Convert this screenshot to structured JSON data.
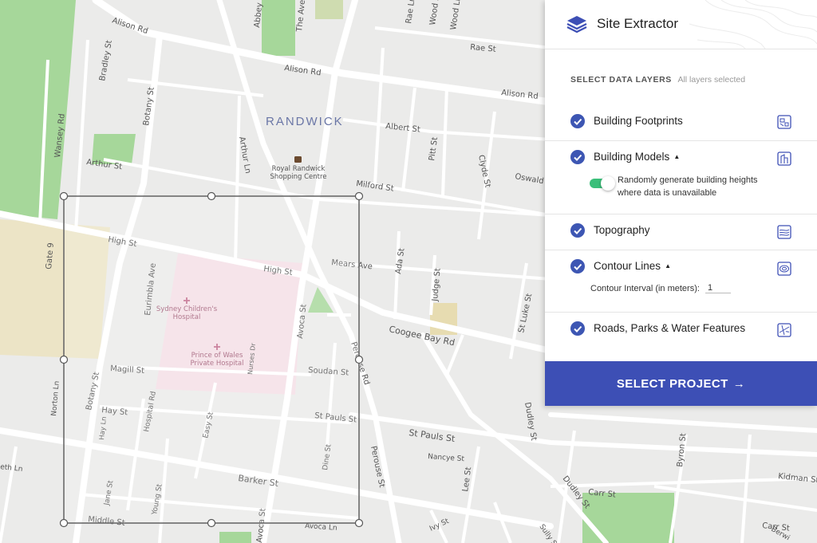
{
  "app": {
    "title": "Site Extractor"
  },
  "layers_panel": {
    "heading": "SELECT DATA LAYERS",
    "subheading": "All layers selected",
    "accent_color": "#3d56b3",
    "layers": [
      {
        "label": "Building Footprints",
        "checked": true,
        "icon": "building-footprints-icon"
      },
      {
        "label": "Building Models",
        "checked": true,
        "expandable": true,
        "icon": "building-models-icon",
        "option": {
          "label": "Randomly generate building heights where data is unavailable",
          "enabled": true
        }
      },
      {
        "label": "Topography",
        "checked": true,
        "icon": "topography-icon"
      },
      {
        "label": "Contour Lines",
        "checked": true,
        "expandable": true,
        "icon": "contour-lines-icon",
        "option": {
          "label": "Contour Interval (in meters):",
          "value": "1"
        }
      },
      {
        "label": "Roads, Parks & Water Features",
        "checked": true,
        "icon": "roads-parks-water-icon"
      }
    ]
  },
  "select_project": {
    "label": "SELECT PROJECT",
    "arrow": "→",
    "color": "#3d4fb5"
  },
  "map": {
    "suburb": "RANDWICK",
    "pois": {
      "shopping_centre": [
        "Royal Randwick",
        "Shopping Centre"
      ],
      "childrens_hospital": [
        "Sydney Children's",
        "Hospital"
      ],
      "private_hospital": [
        "Prince of Wales",
        "Private Hospital"
      ]
    },
    "streets": {
      "alison_rd_1": "Alison Rd",
      "alison_rd_2": "Alison Rd",
      "alison_rd_3": "Alison Rd",
      "bradley_st": "Bradley St",
      "botany_st_1": "Botany St",
      "botany_st_2": "Botany St",
      "wansey_rd": "Wansey Rd",
      "arthur_st": "Arthur St",
      "arthur_ln": "Arthur Ln",
      "abbey_st": "Abbey St",
      "the_avenue": "The Avenue",
      "rae_ln": "Rae Ln",
      "wood_st": "Wood St",
      "wood_ln": "Wood Ln",
      "rae_st": "Rae St",
      "albert_st": "Albert St",
      "pitt_st": "Pitt St",
      "clyde_st": "Clyde St",
      "oswald_st": "Oswald St",
      "milford_st": "Milford St",
      "high_st_1": "High St",
      "high_st_2": "High St",
      "gate_9": "Gate 9",
      "mears_ave": "Mears Ave",
      "ada_st": "Ada St",
      "judge_st": "Judge St",
      "st_lukes_st": "St Luke St",
      "coogee_bay_rd": "Coogee Bay Rd",
      "eurimbla_ave": "Eurimbla Ave",
      "avoca_st_1": "Avoca St",
      "avoca_st_2": "Avoca St",
      "avoca_ln": "Avoca Ln",
      "perouse_rd": "Perouse Rd",
      "perouse_st": "Perouse St",
      "magill_st": "Magill St",
      "soudan_st": "Soudan St",
      "nurses_dr": "Nurses Dr",
      "hay_st": "Hay St",
      "hay_ln": "Hay Ln",
      "hospital_rd": "Hospital Rd",
      "easy_st": "Easy St",
      "st_pauls_st_1": "St Pauls St",
      "st_pauls_st_2": "St Pauls St",
      "norton_ln": "Norton Ln",
      "nancye_st": "Nancye St",
      "dudley_st_1": "Dudley St",
      "dudley_st_2": "Dudley St",
      "byron_st": "Byron St",
      "lee_st": "Lee St",
      "dine_st": "Dine St",
      "barker_st": "Barker St",
      "kidman_st": "Kidman St",
      "carr_st_1": "Carr St",
      "carr_st_2": "Carr St",
      "jane_st": "Jane St",
      "young_st": "Young St",
      "middle_st": "Middle St",
      "ivy_st": "Ivy St",
      "sully_st": "Sully St",
      "berwick": "Berwi",
      "seth_ln": "eth Ln"
    }
  }
}
